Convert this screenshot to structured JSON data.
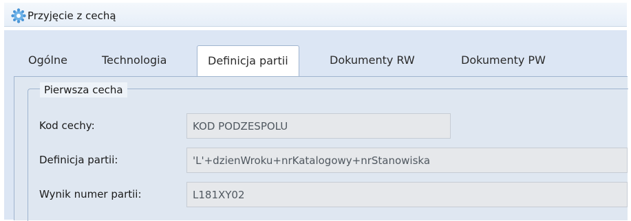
{
  "window": {
    "title": "Przyjęcie z cechą",
    "icon": "gear-app-icon"
  },
  "tabs": [
    {
      "label": "Ogólne",
      "active": false
    },
    {
      "label": "Technologia",
      "active": false
    },
    {
      "label": "Definicja partii",
      "active": true
    },
    {
      "label": "Dokumenty RW",
      "active": false
    },
    {
      "label": "Dokumenty PW",
      "active": false
    }
  ],
  "group": {
    "title": "Pierwsza cecha",
    "fields": [
      {
        "label": "Kod cechy:",
        "value": "KOD PODZESPOLU"
      },
      {
        "label": "Definicja partii:",
        "value": "'L'+dzienWroku+nrKatalogowy+nrStanowiska"
      },
      {
        "label": "Wynik numer partii:",
        "value": "L181XY02"
      }
    ]
  },
  "colors": {
    "panel": "#dce6f4",
    "tab_border": "#9fb4cf",
    "field_bg": "#e6e8eb"
  }
}
